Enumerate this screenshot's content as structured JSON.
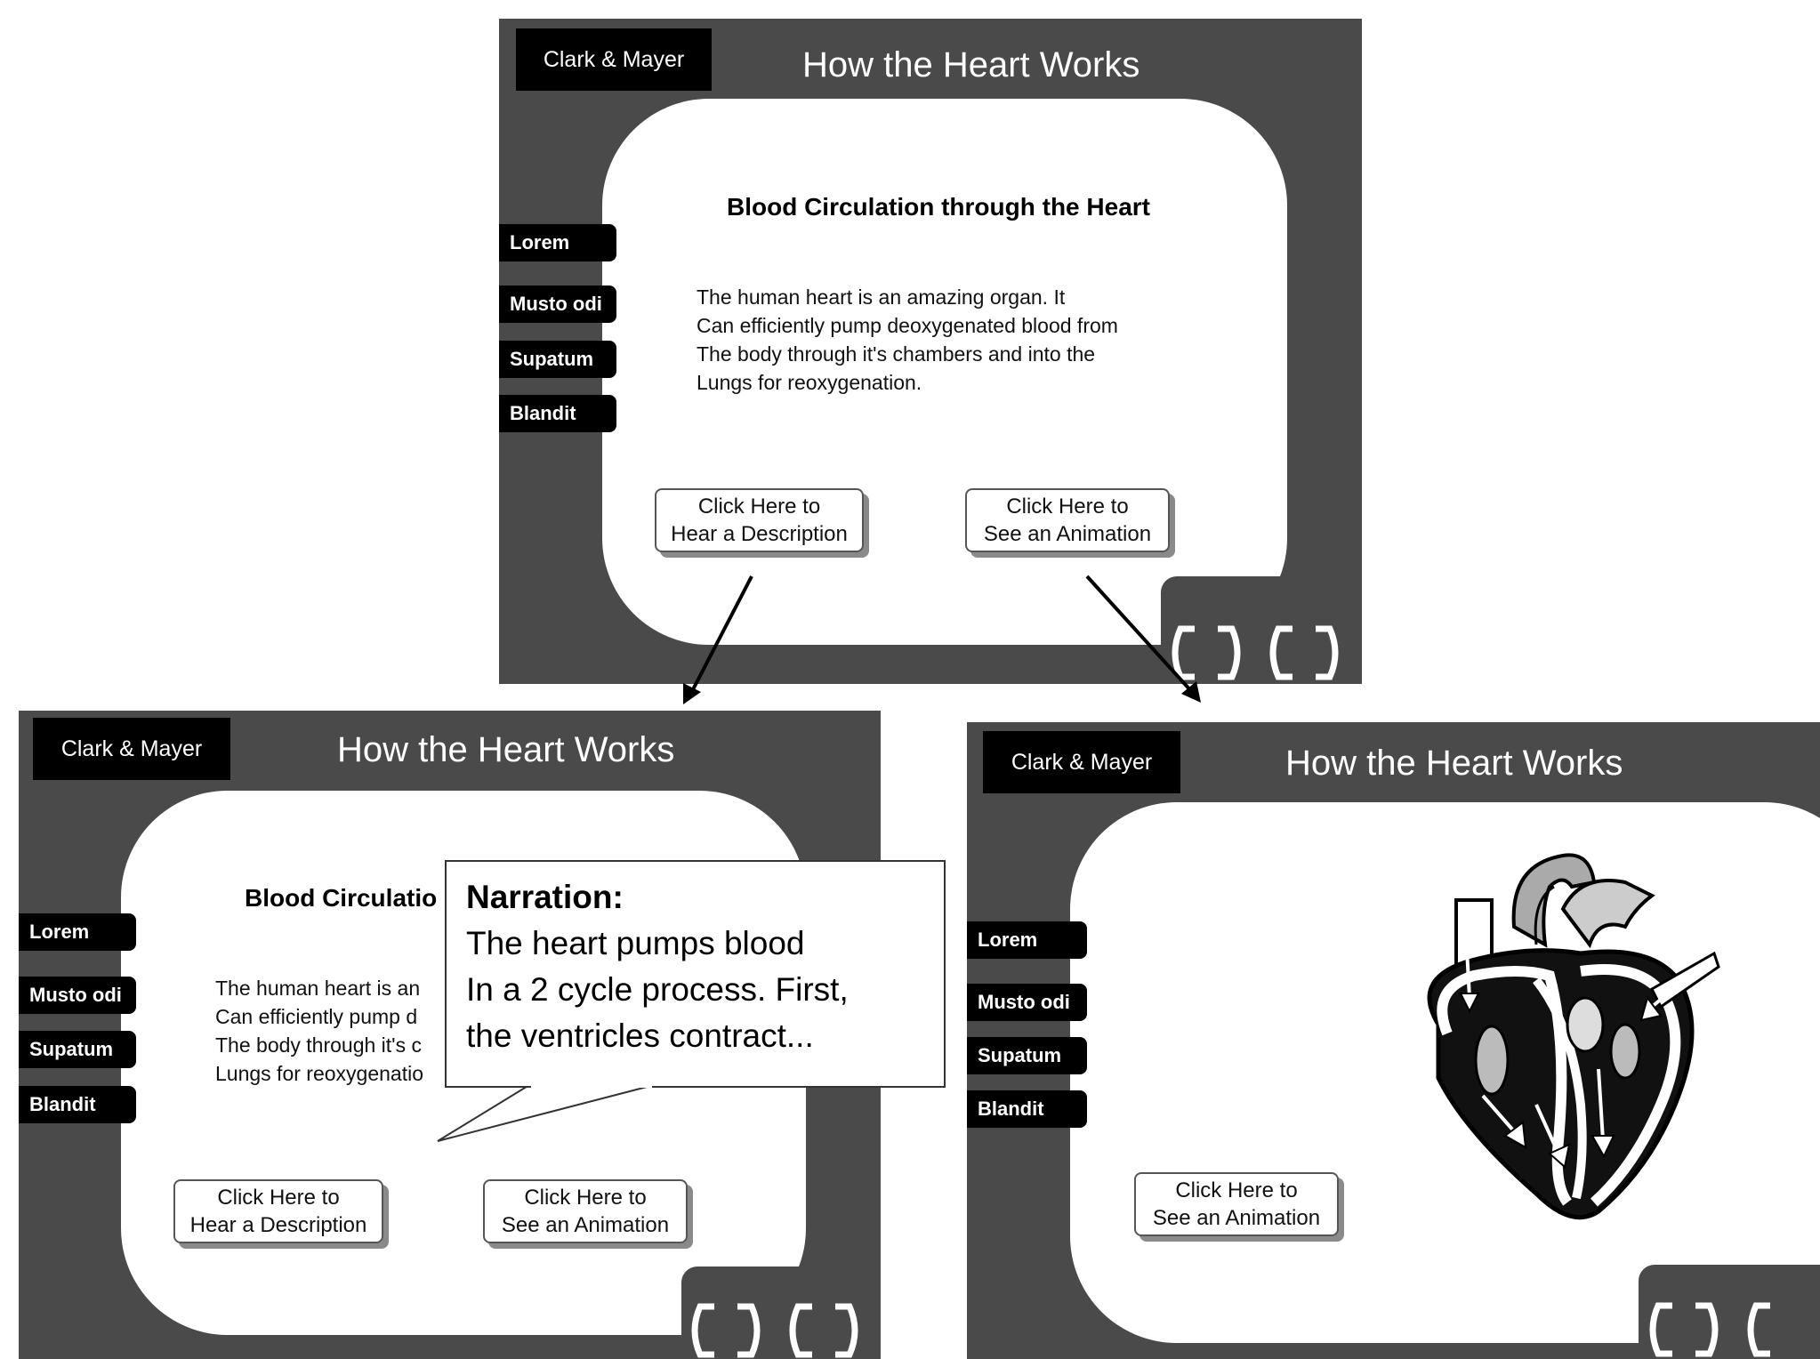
{
  "brand": "Clark & Mayer",
  "title": "How the Heart Works",
  "nav_items": [
    "Lorem",
    "Musto odi",
    "Supatum",
    "Blandit"
  ],
  "heading": "Blood Circulation through the Heart",
  "heading_truncated": "Blood Circulatio",
  "body_lines": [
    "The human heart is an amazing organ.  It",
    "Can efficiently pump deoxygenated blood from",
    "The body through it's chambers and into the",
    "Lungs for reoxygenation."
  ],
  "body_lines_truncated": [
    "The human heart is an",
    "Can efficiently pump d",
    "The body through it's c",
    "Lungs for reoxygenatio"
  ],
  "buttons": {
    "describe": [
      "Click Here to",
      "Hear a Description"
    ],
    "animate": [
      "Click Here to",
      "See an Animation"
    ]
  },
  "narration": {
    "label": "Narration:",
    "lines": [
      "The heart pumps blood",
      "In a 2 cycle process. First,",
      "the ventricles contract..."
    ]
  },
  "icons": [
    "heart-illustration",
    "prev-nav-icon",
    "next-nav-icon"
  ],
  "colors": {
    "frame": "#4a4a4a",
    "nav": "#000000",
    "panel": "#ffffff"
  }
}
